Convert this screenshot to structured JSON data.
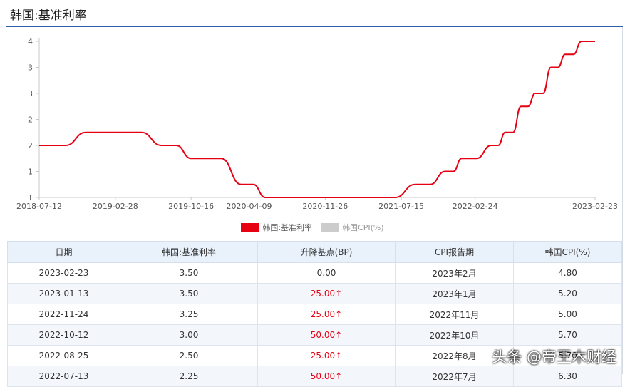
{
  "page": {
    "title": "韩国:基准利率"
  },
  "chart_data": {
    "type": "line",
    "x_ticks": [
      "2018-07-12",
      "2019-02-28",
      "2019-10-16",
      "2020-04-09",
      "2020-11-26",
      "2021-07-15",
      "2022-02-24",
      "2023-02-23"
    ],
    "y_ticks": [
      "4",
      "3",
      "3",
      "2",
      "2",
      "1",
      "1"
    ],
    "series": [
      {
        "name": "韩国:基准利率",
        "color": "#e60012",
        "x": [
          "2018-07-12",
          "2018-11-30",
          "2019-07-18",
          "2019-10-16",
          "2020-03-16",
          "2020-05-28",
          "2021-08-26",
          "2021-11-25",
          "2022-01-14",
          "2022-04-14",
          "2022-05-26",
          "2022-07-13",
          "2022-08-25",
          "2022-10-12",
          "2022-11-24",
          "2023-01-13",
          "2023-02-23"
        ],
        "values": [
          1.5,
          1.75,
          1.5,
          1.25,
          0.75,
          0.5,
          0.75,
          1.0,
          1.25,
          1.5,
          1.75,
          2.25,
          2.5,
          3.0,
          3.25,
          3.5,
          3.5
        ]
      }
    ],
    "legend": [
      {
        "label": "韩国:基准利率",
        "color": "#e60012"
      },
      {
        "label": "韩国CPI(%)",
        "color": "#cccccc"
      }
    ]
  },
  "table": {
    "headers": [
      "日期",
      "韩国:基准利率",
      "升降基点(BP)",
      "CPI报告期",
      "韩国CPI(%)"
    ],
    "rows": [
      {
        "date": "2023-02-23",
        "rate": "3.50",
        "bp": "0.00",
        "cpi_period": "2023年2月",
        "cpi": "4.80"
      },
      {
        "date": "2023-01-13",
        "rate": "3.50",
        "bp": "25.00↑",
        "cpi_period": "2023年1月",
        "cpi": "5.20"
      },
      {
        "date": "2022-11-24",
        "rate": "3.25",
        "bp": "25.00↑",
        "cpi_period": "2022年11月",
        "cpi": "5.00"
      },
      {
        "date": "2022-10-12",
        "rate": "3.00",
        "bp": "50.00↑",
        "cpi_period": "2022年10月",
        "cpi": "5.70"
      },
      {
        "date": "2022-08-25",
        "rate": "2.50",
        "bp": "25.00↑",
        "cpi_period": "2022年8月",
        "cpi": "5.70"
      },
      {
        "date": "2022-07-13",
        "rate": "2.25",
        "bp": "50.00↑",
        "cpi_period": "2022年7月",
        "cpi": "6.30"
      }
    ]
  },
  "watermark": {
    "text": "头条 @帝王木财经"
  }
}
